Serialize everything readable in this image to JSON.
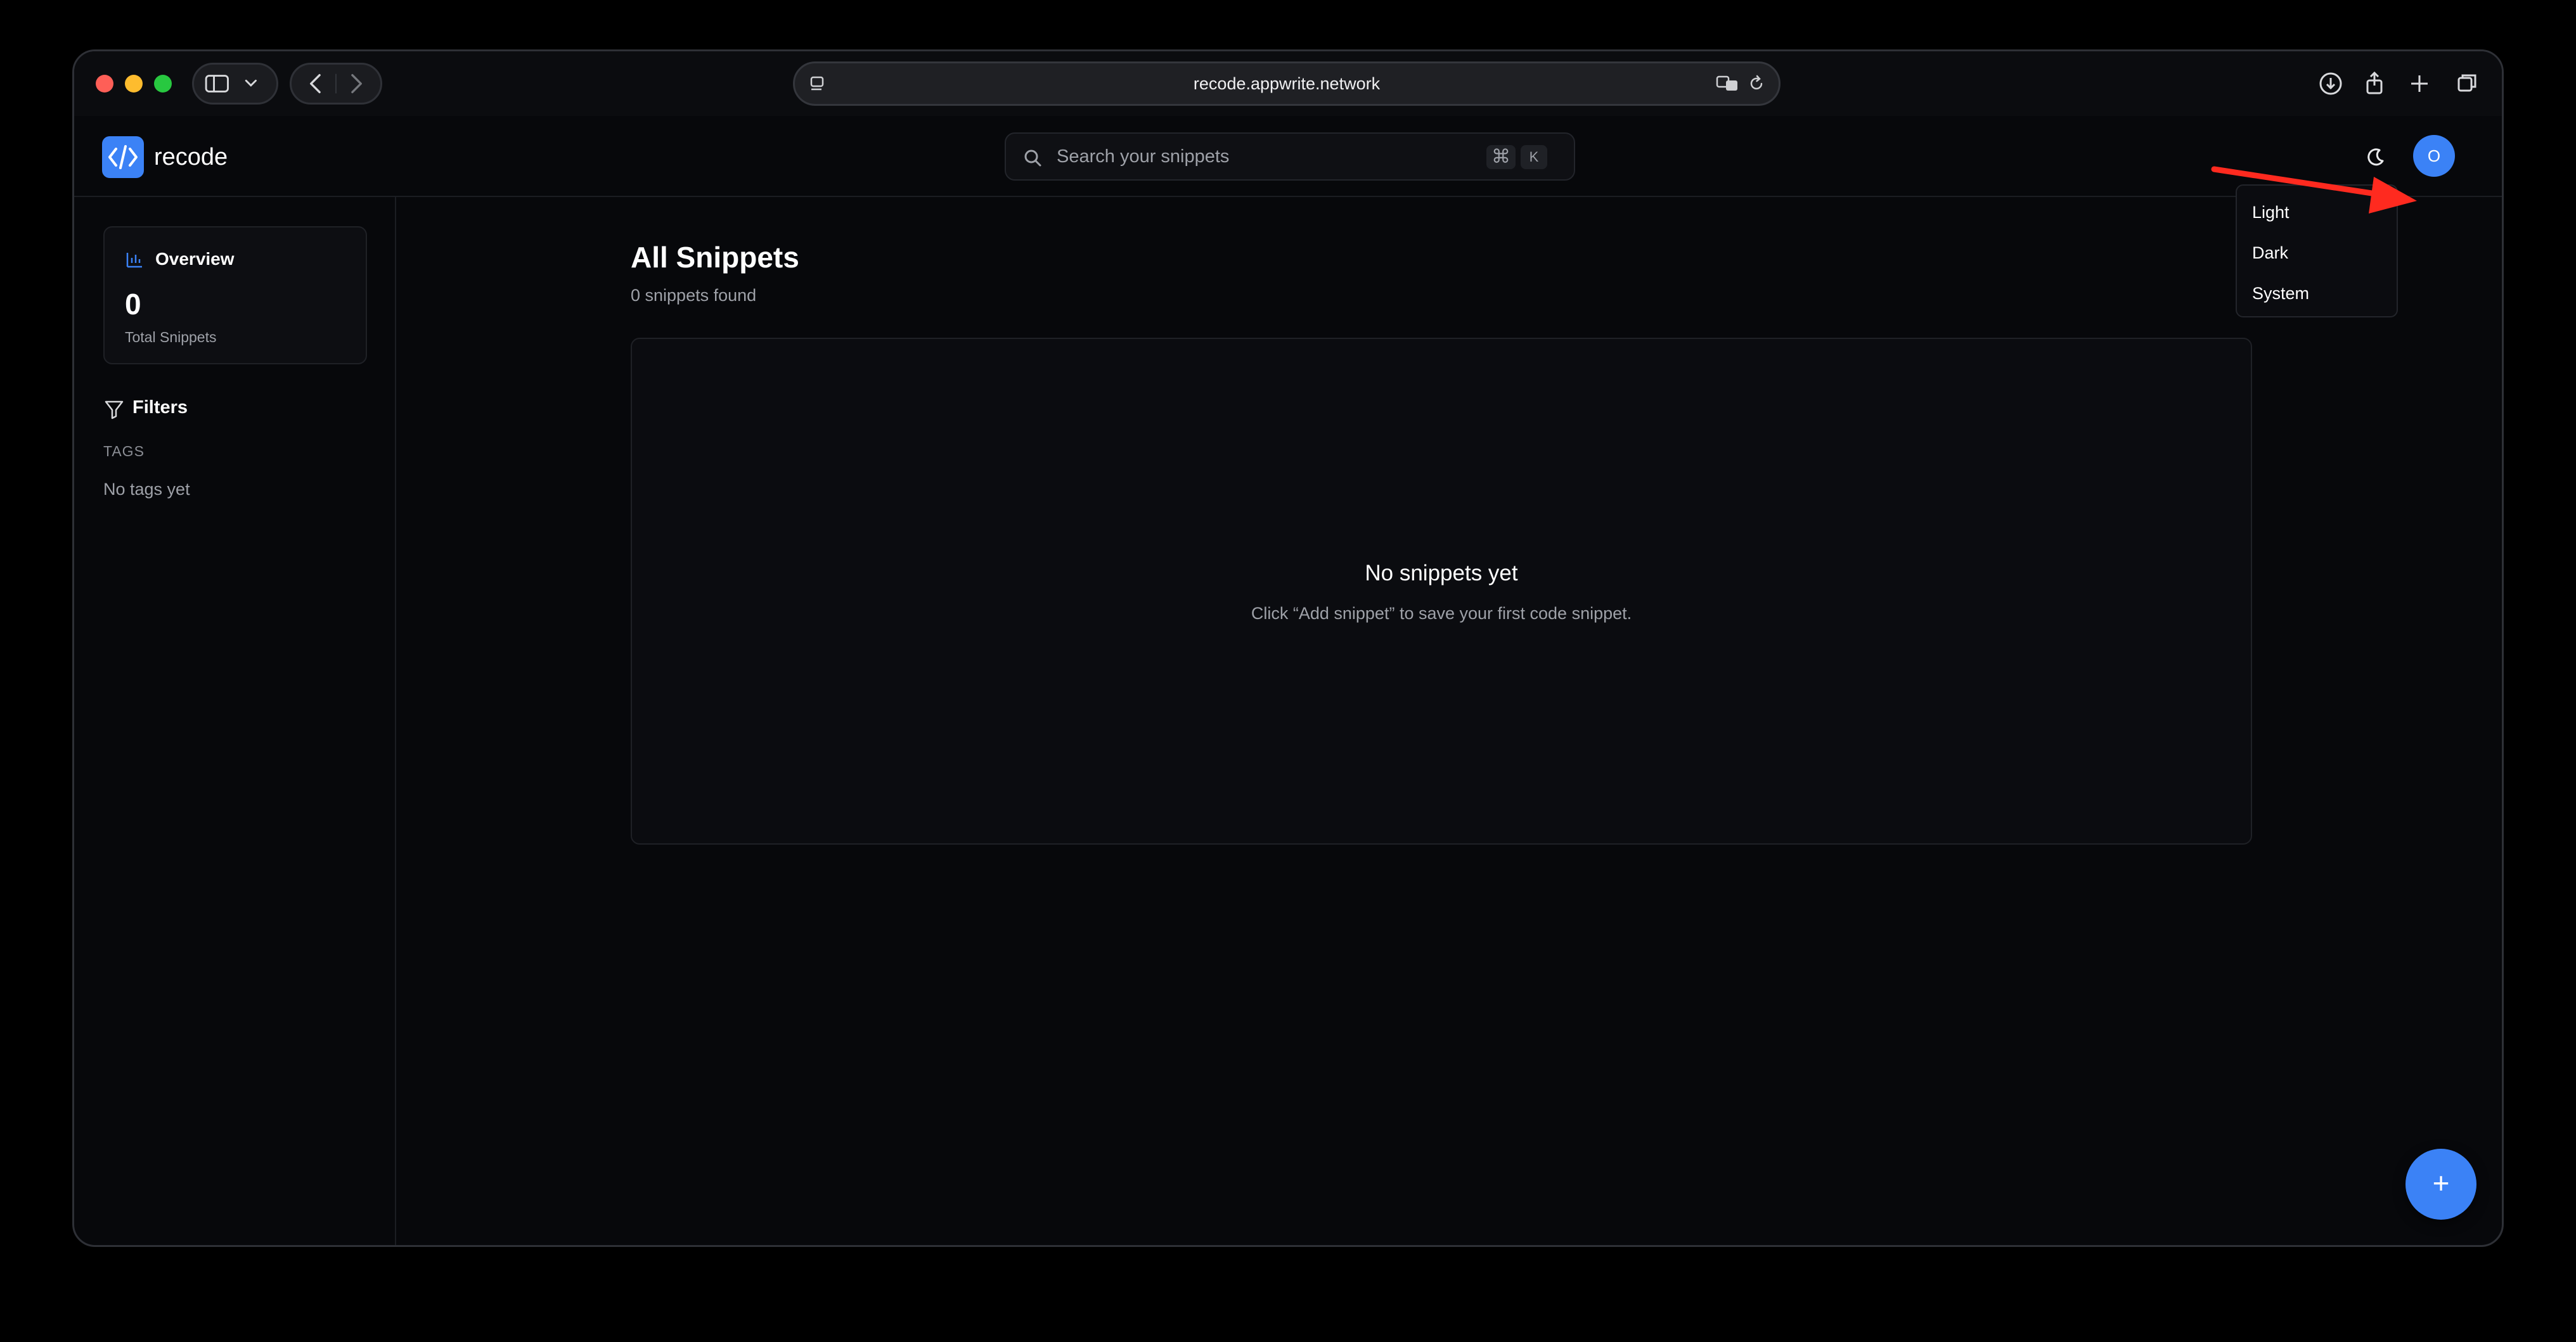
{
  "browser": {
    "url": "recode.appwrite.network"
  },
  "app": {
    "name": "recode",
    "search_placeholder": "Search your snippets",
    "shortcut_cmd": "⌘",
    "shortcut_key": "K",
    "avatar_initial": "O"
  },
  "sidebar": {
    "overview_title": "Overview",
    "total_count": "0",
    "total_label": "Total Snippets",
    "filters_title": "Filters",
    "tags_heading": "TAGS",
    "tags_empty": "No tags yet"
  },
  "main": {
    "title": "All Snippets",
    "subtitle": "0 snippets found",
    "empty_title": "No snippets yet",
    "empty_desc": "Click “Add snippet” to save your first code snippet."
  },
  "theme_menu": {
    "items": [
      {
        "label": "Light"
      },
      {
        "label": "Dark"
      },
      {
        "label": "System"
      }
    ]
  },
  "fab": {
    "label": "+"
  },
  "colors": {
    "accent": "#3b82f6",
    "annotation": "#ff2a1f"
  }
}
